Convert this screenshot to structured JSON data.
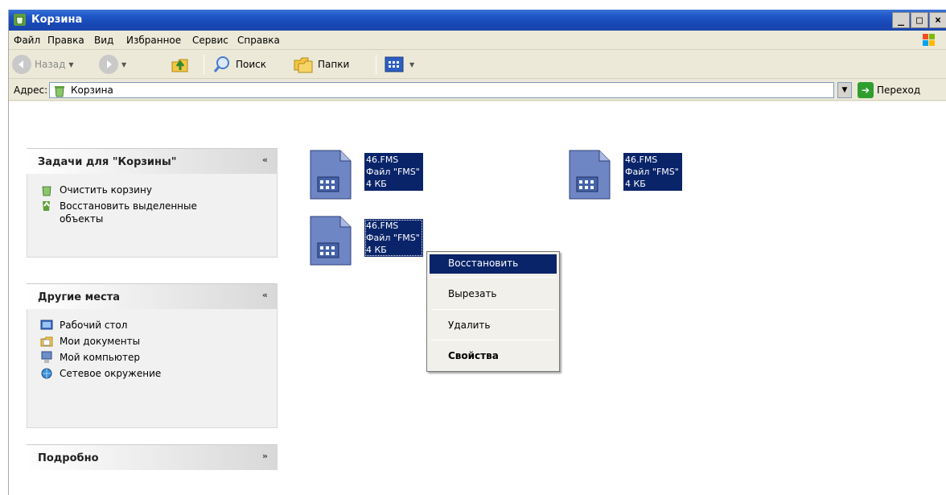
{
  "window": {
    "title": "Корзина",
    "controls": [
      "_",
      "□",
      "×"
    ]
  },
  "menubar": {
    "items": [
      "Файл",
      "Правка",
      "Вид",
      "Избранное",
      "Сервис",
      "Справка"
    ]
  },
  "toolbar": {
    "back_label": "Назад",
    "search_label": "Поиск",
    "folders_label": "Папки"
  },
  "address": {
    "label": "Адрес:",
    "value": "Корзина",
    "go_label": "Переход"
  },
  "taskpane": {
    "tasks": {
      "title": "Задачи для \"Корзины\"",
      "toggle": "«",
      "items": [
        {
          "label": "Очистить корзину",
          "icon": "recycle-bin-icon"
        },
        {
          "label": "Восстановить выделенные объекты",
          "icon": "restore-icon"
        }
      ]
    },
    "places": {
      "title": "Другие места",
      "toggle": "«",
      "items": [
        {
          "label": "Рабочий стол",
          "icon": "desktop-icon"
        },
        {
          "label": "Мои документы",
          "icon": "my-documents-icon"
        },
        {
          "label": "Мой компьютер",
          "icon": "my-computer-icon"
        },
        {
          "label": "Сетевое окружение",
          "icon": "network-icon"
        }
      ]
    },
    "details": {
      "title": "Подробно",
      "toggle": "»"
    }
  },
  "files": [
    {
      "name": "46.FMS",
      "type": "Файл \"FMS\"",
      "size": "4 КБ"
    },
    {
      "name": "46.FMS",
      "type": "Файл \"FMS\"",
      "size": "4 КБ"
    },
    {
      "name": "46.FMS",
      "type": "Файл \"FMS\"",
      "size": "4 КБ"
    }
  ],
  "context_menu": {
    "items": [
      "Восстановить",
      "Вырезать",
      "Удалить",
      "Свойства"
    ],
    "highlighted": "Восстановить",
    "default_item": "Свойства"
  },
  "colors": {
    "titlebar": "#1f57c7",
    "selection": "#0a246a",
    "chrome": "#ECE9D8"
  }
}
